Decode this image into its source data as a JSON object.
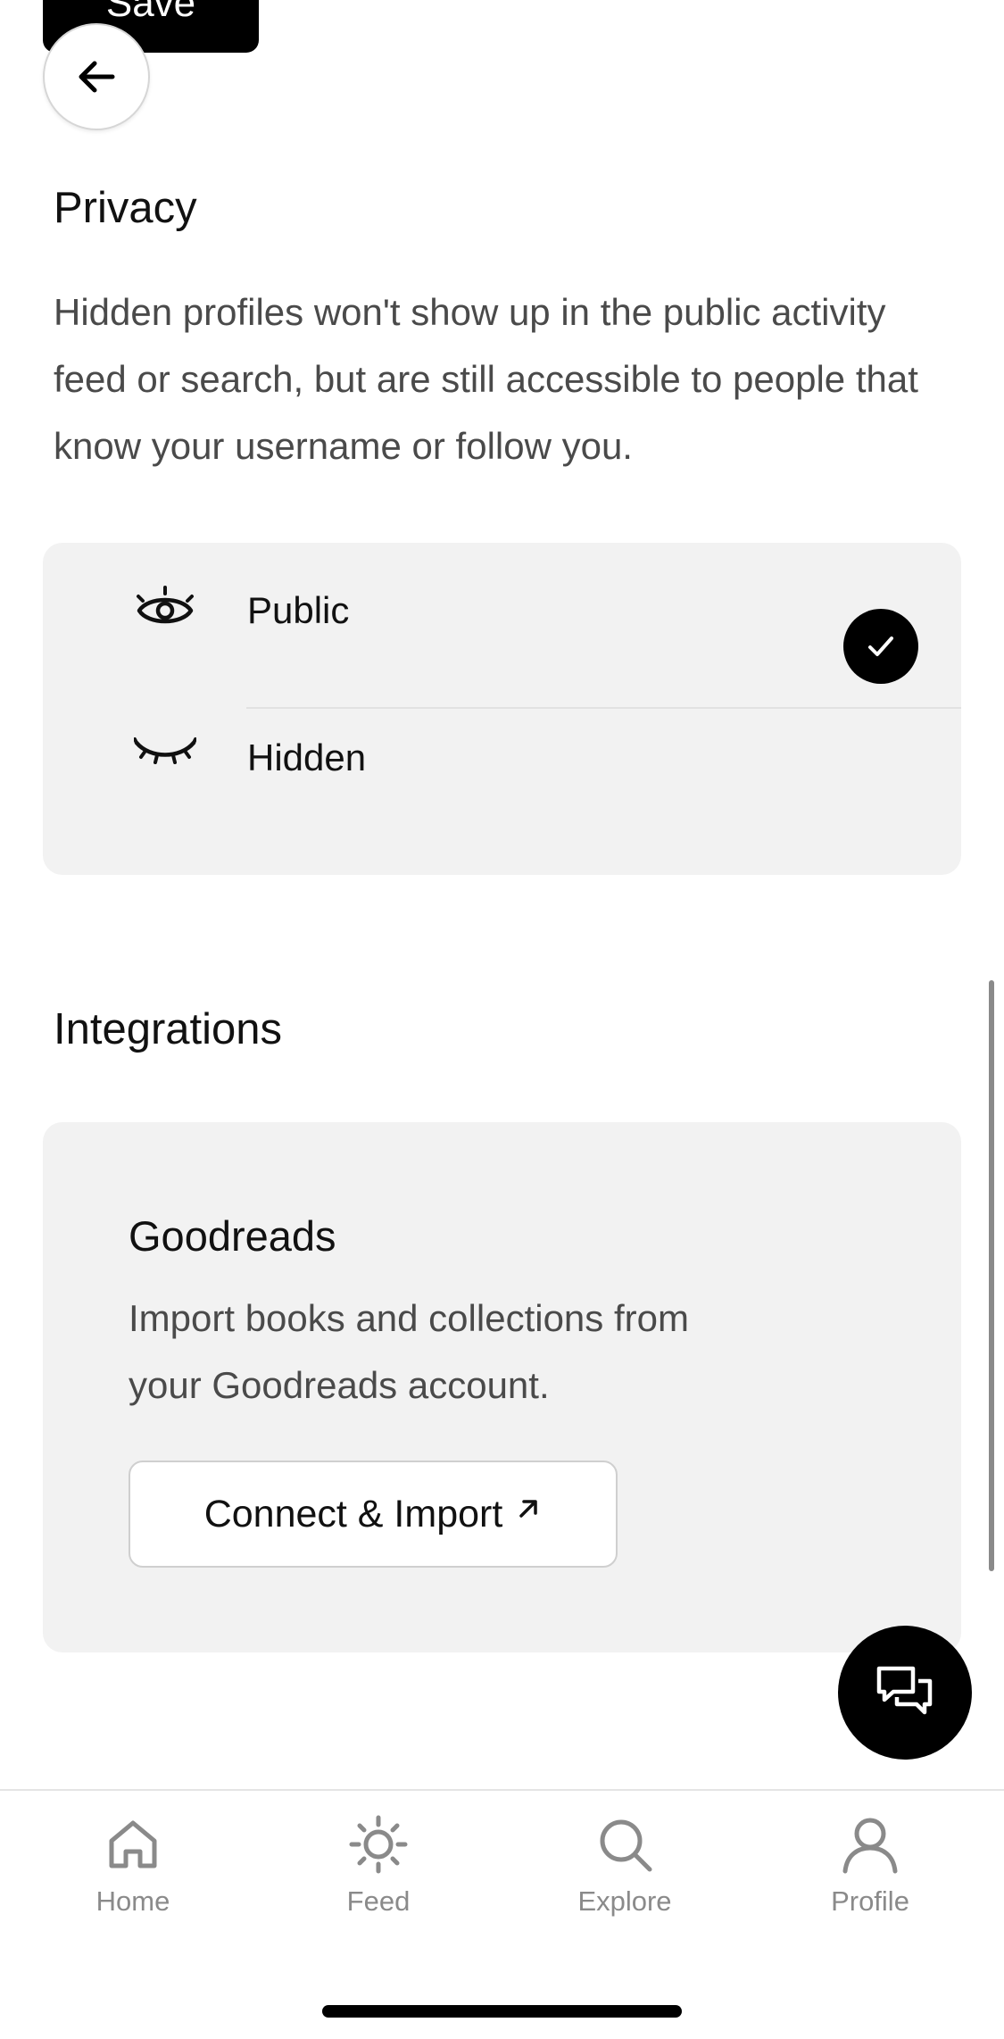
{
  "header": {
    "save_label": "Save"
  },
  "privacy": {
    "title": "Privacy",
    "description": "Hidden profiles won't show up in the public activity feed or search, but are still accessible to people that know your username or follow you.",
    "options": [
      {
        "label": "Public",
        "icon": "eye-open-icon",
        "selected": true
      },
      {
        "label": "Hidden",
        "icon": "eye-closed-icon",
        "selected": false
      }
    ]
  },
  "integrations": {
    "title": "Integrations",
    "goodreads": {
      "name": "Goodreads",
      "description": "Import books and collections from your Goodreads account.",
      "button_label": "Connect & Import",
      "button_icon": "external-arrow-icon"
    }
  },
  "tabs": [
    {
      "label": "Home",
      "icon": "home-icon"
    },
    {
      "label": "Feed",
      "icon": "sun-icon"
    },
    {
      "label": "Explore",
      "icon": "search-icon"
    },
    {
      "label": "Profile",
      "icon": "person-icon"
    }
  ],
  "colors": {
    "accent": "#000000",
    "card_background": "#f2f2f2",
    "muted_text": "#8a8a8a"
  }
}
